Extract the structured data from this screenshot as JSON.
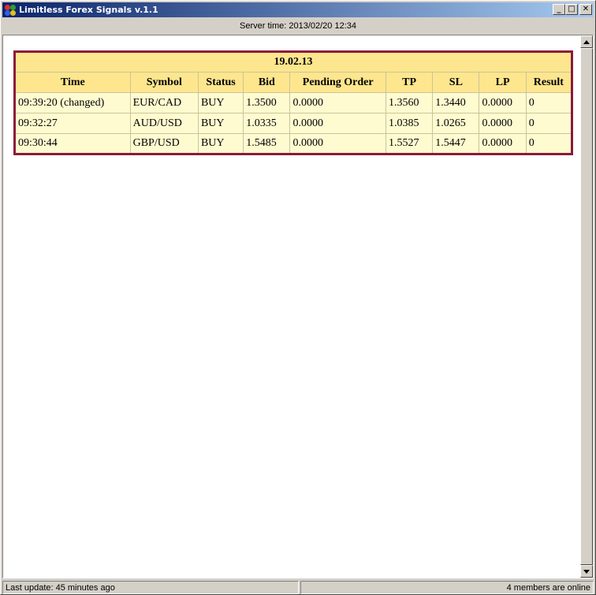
{
  "window": {
    "title": "Limitless Forex Signals v.1.1",
    "controls": {
      "minimize": "_",
      "maximize": "□",
      "close": "✕"
    }
  },
  "server_time": "Server time: 2013/02/20 12:34",
  "table": {
    "date": "19.02.13",
    "columns": [
      "Time",
      "Symbol",
      "Status",
      "Bid",
      "Pending Order",
      "TP",
      "SL",
      "LP",
      "Result"
    ],
    "rows": [
      [
        "09:39:20 (changed)",
        "EUR/CAD",
        "BUY",
        "1.3500",
        "0.0000",
        "1.3560",
        "1.3440",
        "0.0000",
        "0"
      ],
      [
        "09:32:27",
        "AUD/USD",
        "BUY",
        "1.0335",
        "0.0000",
        "1.0385",
        "1.0265",
        "0.0000",
        "0"
      ],
      [
        "09:30:44",
        "GBP/USD",
        "BUY",
        "1.5485",
        "0.0000",
        "1.5527",
        "1.5447",
        "0.0000",
        "0"
      ]
    ]
  },
  "status": {
    "last_update": "Last update: 45 minutes ago",
    "members_online": "4 members are online"
  },
  "colors": {
    "title_gradient_start": "#0a246a",
    "title_gradient_end": "#a6caf0",
    "table_border": "#8b1a3a",
    "header_bg": "#fde68e",
    "cell_bg": "#fffbd0"
  },
  "icons": {
    "app": "four-dot-app-icon",
    "scroll_up": "arrow-up-icon",
    "scroll_down": "arrow-down-icon"
  }
}
